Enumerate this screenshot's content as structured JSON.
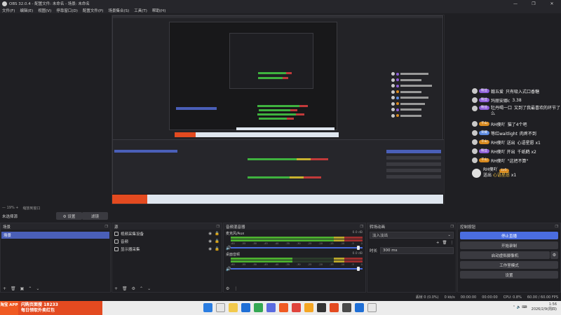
{
  "window": {
    "title": "OBS 32.0.4 - 配置文件: 未命名 - 场景: 未命名",
    "controls": [
      "—",
      "❐",
      "✕"
    ]
  },
  "menu": [
    "文件(F)",
    "编辑(E)",
    "视图(V)",
    "停靠窗口(D)",
    "配置文件(P)",
    "场景集合(S)",
    "工具(T)",
    "帮助(H)"
  ],
  "chat": {
    "lines": [
      {
        "badge": "粉丝",
        "badge_color": "#8e5fd8",
        "name": "翰五爱",
        "text": "只有吸入式口香糖"
      },
      {
        "badge": "粉丝",
        "badge_color": "#8e5fd8",
        "name": "玛丽安娜c",
        "text": "3.38"
      },
      {
        "badge": "粉丝",
        "badge_color": "#8e5fd8",
        "name": "牡丹喝一口",
        "text": "又到了我最喜欢的环节了么"
      },
      {
        "badge": "千山",
        "badge_color": "#d88a1f",
        "name": "RH傻吖",
        "text": "猫了4个吧"
      },
      {
        "badge": "荣耀",
        "badge_color": "#5b8ae0",
        "name": "等红waitlight",
        "text": "肉疼不到"
      },
      {
        "badge": "千山",
        "badge_color": "#d88a1f",
        "name": "RH傻吖 送出",
        "text": "心语星愿  x1"
      },
      {
        "badge": "粉丝",
        "badge_color": "#8e5fd8",
        "name": "RH傻吖 开出",
        "text": "千纸鹤  x2"
      },
      {
        "badge": "千山",
        "badge_color": "#d88a1f",
        "name": "RH傻吖",
        "text": "\"这把不算\""
      }
    ],
    "gift": {
      "name": "RH傻吖",
      "level": "Lv5",
      "action": "送出",
      "item": "心语星愿",
      "count": "x1"
    }
  },
  "scene_bar": {
    "zoom": "— 19% +",
    "fit": "缩放到窗口"
  },
  "title_row": {
    "current": "未选择源",
    "settings_btn": "⚙ 设置",
    "filter_btn": "滤镜"
  },
  "docks": {
    "scenes": {
      "title": "场景",
      "items": [
        "场景"
      ]
    },
    "sources": {
      "title": "源",
      "items": [
        {
          "name": "视频采集设备",
          "icon": "camera-icon"
        },
        {
          "name": "音频",
          "icon": "speaker-icon"
        },
        {
          "name": "显示器采集",
          "icon": "monitor-icon"
        }
      ]
    },
    "mixer": {
      "title": "音频混音器",
      "tracks": [
        {
          "name": "麦克风/Aux",
          "db": "0.0 dB",
          "level": 0.78
        },
        {
          "name": "桌面音频",
          "db": "0.0 dB",
          "level": 0.47
        }
      ],
      "scale": [
        "-60",
        "-55",
        "-50",
        "-45",
        "-40",
        "-35",
        "-30",
        "-25",
        "-20",
        "-15",
        "-10",
        "-5",
        "0"
      ]
    },
    "transitions": {
      "title": "转场动画",
      "selected": "淡入淡出",
      "duration_label": "时长",
      "duration": "300 ms"
    },
    "controls": {
      "title": "控制按钮",
      "buttons": [
        "停止直播",
        "开始录制",
        "启动虚拟摄像机",
        "工作室模式",
        "设置"
      ]
    }
  },
  "status": {
    "drop": "丢帧 0 (0.0%)",
    "bitrate": "0 kb/s",
    "live": "00:00:00",
    "rec": "00:00:00",
    "cpu": "CPU: 0.8%",
    "fps": "60.00 / 60.00 FPS"
  },
  "ad": {
    "logo": "淘宝 APP",
    "line1": "闪购页面搜 18233",
    "line2": "每日领取外卖红包"
  },
  "tray": {
    "time": "1:56",
    "date": "2026/2/9(周四)"
  }
}
